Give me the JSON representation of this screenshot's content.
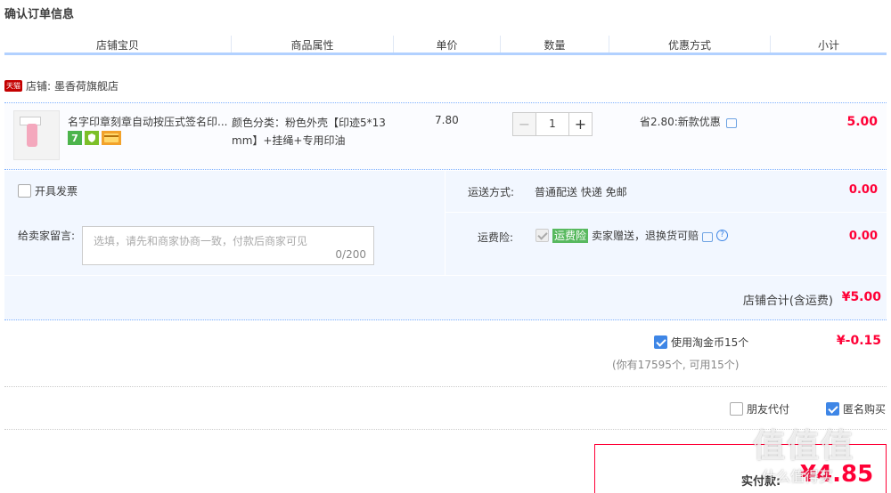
{
  "page": {
    "title": "确认订单信息"
  },
  "columns": [
    "店铺宝贝",
    "商品属性",
    "单价",
    "数量",
    "优惠方式",
    "小计"
  ],
  "shop": {
    "tag": "天猫",
    "label": "店铺:",
    "name": "墨香荷旗舰店"
  },
  "item": {
    "name": "名字印章刻章自动按压式签名印...",
    "badge_days": "7",
    "attr_line1": "颜色分类：粉色外壳【印迹5*13",
    "attr_line2": "mm】+挂绳+专用印油",
    "price": "7.80",
    "qty": "1",
    "minus": "−",
    "plus": "+",
    "promo": "省2.80:新款优惠",
    "subtotal": "5.00"
  },
  "invoice": {
    "label": "开具发票"
  },
  "memo": {
    "label": "给卖家留言:",
    "placeholder": "选填，请先和商家协商一致，付款后商家可见",
    "count": "0/200"
  },
  "shipping": {
    "label": "运送方式:",
    "value": "普通配送 快递 免邮",
    "fee": "0.00"
  },
  "insurance": {
    "label": "运费险:",
    "tag": "运费险",
    "desc": "卖家赠送，退换货可赔",
    "help": "?",
    "fee": "0.00"
  },
  "shop_total": {
    "label": "店铺合计(含运费)",
    "amount": "¥5.00"
  },
  "coins": {
    "label": "使用淘金币15个",
    "sub": "(你有17595个, 可用15个)",
    "amount": "¥-0.15"
  },
  "friend_pay": {
    "label": "朋友代付"
  },
  "anonymous": {
    "label": "匿名购买"
  },
  "pay": {
    "label": "实付款:",
    "amount": "¥4.85"
  },
  "watermark": {
    "line1": "值值值",
    "line2": "什么值得买"
  },
  "colors": {
    "accent_red": "#ff0036",
    "blue_line": "#b2d1ff",
    "panel_bg": "#f2f7ff",
    "checkbox_blue": "#3e86e6"
  }
}
